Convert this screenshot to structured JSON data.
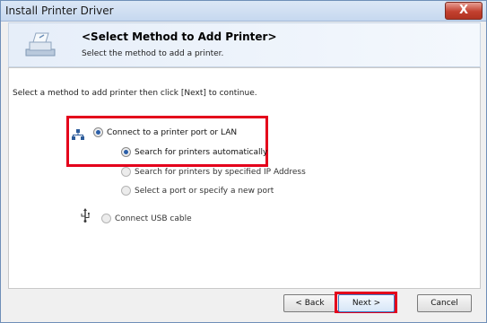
{
  "window": {
    "title": "Install Printer Driver",
    "close_glyph": "X"
  },
  "header": {
    "title": "<Select Method to Add Printer>",
    "subtitle": "Select the method to add a printer.",
    "icon": "printer-wizard-icon"
  },
  "main": {
    "instruction": "Select a method to add printer then click [Next] to continue.",
    "options": [
      {
        "label": "Connect to a printer port or LAN",
        "selected": true,
        "icon": "lan-network-icon"
      },
      {
        "label": "Search for printers automatically",
        "selected": true
      },
      {
        "label": "Search for printers by specified IP Address",
        "selected": false
      },
      {
        "label": "Select a port or specify a new port",
        "selected": false
      },
      {
        "label": "Connect USB cable",
        "selected": false,
        "icon": "usb-icon"
      }
    ]
  },
  "footer": {
    "back_label": "< Back",
    "next_label": "Next >",
    "cancel_label": "Cancel"
  },
  "colors": {
    "highlight": "#e4001b",
    "title_bar": "#c6d8ef",
    "close_button": "#c2402f"
  }
}
